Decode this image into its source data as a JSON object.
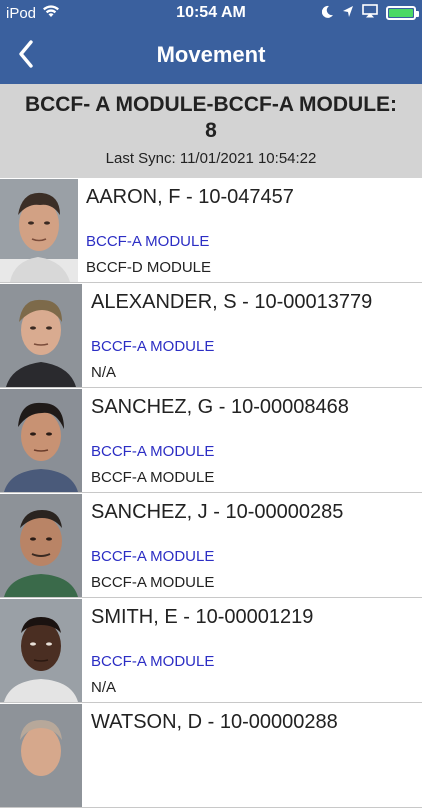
{
  "status_bar": {
    "carrier": "iPod",
    "time": "10:54 AM",
    "icons": [
      "wifi-icon",
      "moon-icon",
      "location-icon",
      "airplay-icon",
      "battery-icon"
    ],
    "battery_color": "#4cd964"
  },
  "nav": {
    "title": "Movement",
    "back_icon": "chevron-left-icon",
    "background": "#3a609e"
  },
  "header": {
    "title": "BCCF- A MODULE-BCCF-A MODULE: 8",
    "last_sync": "Last Sync: 11/01/2021 10:54:22"
  },
  "inmates": [
    {
      "name": "AARON, F - 10-047457",
      "current_location": "BCCF-A MODULE",
      "destination": "BCCF-D MODULE"
    },
    {
      "name": "ALEXANDER, S - 10-00013779",
      "current_location": "BCCF-A MODULE",
      "destination": "N/A"
    },
    {
      "name": "SANCHEZ, G - 10-00008468",
      "current_location": "BCCF-A MODULE",
      "destination": "BCCF-A MODULE"
    },
    {
      "name": "SANCHEZ, J - 10-00000285",
      "current_location": "BCCF-A MODULE",
      "destination": "BCCF-A MODULE"
    },
    {
      "name": "SMITH, E - 10-00001219",
      "current_location": "BCCF-A MODULE",
      "destination": "N/A"
    },
    {
      "name": "WATSON, D - 10-00000288",
      "current_location": "",
      "destination": ""
    }
  ]
}
